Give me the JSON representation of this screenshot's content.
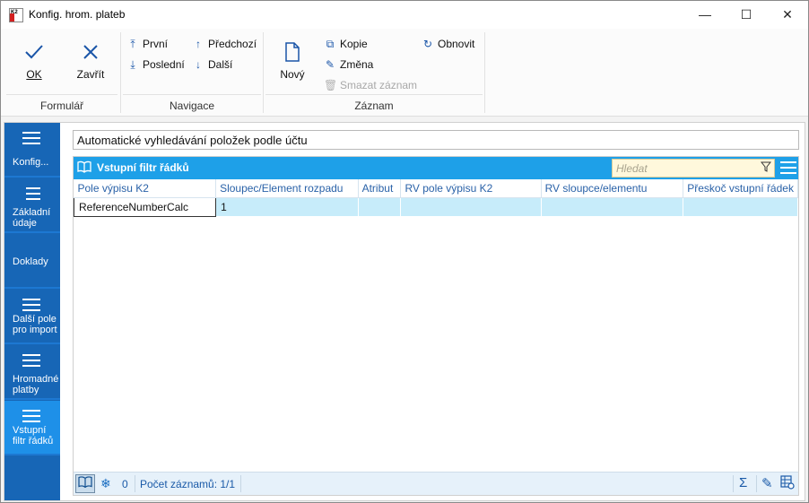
{
  "window": {
    "title": "Konfig. hrom. plateb",
    "app_icon_text": "K2",
    "minimize": "—",
    "maximize": "☐",
    "close": "✕"
  },
  "ribbon": {
    "formular": {
      "ok": "OK",
      "close": "Zavřít",
      "group": "Formulář"
    },
    "navigace": {
      "first": "První",
      "last": "Poslední",
      "prev": "Předchozí",
      "next": "Další",
      "group": "Navigace"
    },
    "zaznam": {
      "new": "Nový",
      "copy": "Kopie",
      "change": "Změna",
      "delete": "Smazat záznam",
      "refresh": "Obnovit",
      "group": "Záznam"
    }
  },
  "nav": {
    "items": [
      {
        "label": "Konfig...",
        "icon": "hamburger-icon",
        "active": false
      },
      {
        "label": "Základní údaje",
        "icon": "list-icon",
        "active": false
      },
      {
        "label": "Doklady",
        "icon": "",
        "active": false
      },
      {
        "label": "Další pole pro import",
        "icon": "hamburger-icon",
        "active": false
      },
      {
        "label": "Hromadné platby",
        "icon": "hamburger-icon",
        "active": false
      },
      {
        "label": "Vstupní filtr řádků",
        "icon": "hamburger-icon",
        "active": true
      }
    ]
  },
  "description": "Automatické vyhledávání položek podle účtu",
  "panel": {
    "title": "Vstupní filtr řádků",
    "search_placeholder": "Hledat",
    "columns": [
      "Pole výpisu K2",
      "Sloupec/Element rozpadu",
      "Atribut",
      "RV pole výpisu K2",
      "RV sloupce/elementu",
      "Přeskoč vstupní řádek"
    ],
    "rows": [
      [
        "ReferenceNumberCalc",
        "1",
        "",
        "",
        "",
        ""
      ]
    ]
  },
  "status": {
    "filter_count": "0",
    "record_count": "Počet záznamů: 1/1"
  },
  "colors": {
    "nav_bg": "#1766b6",
    "nav_active": "#1e90e8",
    "panel_header": "#1ea0e8",
    "row_bg": "#c7ecfa",
    "search_bg": "#fff8dc"
  }
}
